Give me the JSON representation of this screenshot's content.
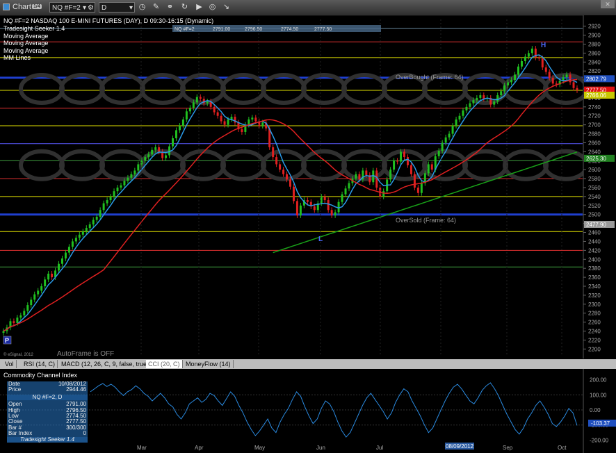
{
  "toolbar": {
    "app_title": "Chart",
    "app_badge": "1/4",
    "symbol": "NQ #F=2",
    "interval": "D"
  },
  "chart": {
    "header": "NQ #F=2 NASDAQ 100 E-MINI FUTURES (DAY), D 09:30-16:15 (Dynamic)",
    "studies": [
      "Tradesight Seeker 1.4",
      "Moving Average",
      "Moving Average",
      "Moving Average",
      "MM Lines"
    ],
    "ohlc_strip": [
      "NQ #F=2",
      "2791.00",
      "2796.50",
      "2774.50",
      "2777.50"
    ],
    "overbought_label": "OverBought (Frame: 64)",
    "oversold_label": "OverSold (Frame: 64)",
    "autoframe": "AutoFrame is OFF",
    "copyright": "© eSignal, 2012",
    "p_marker": "P",
    "h_marker": "H",
    "l_marker": "L"
  },
  "chart_data": [
    {
      "type": "candlestick",
      "title": "NQ #F=2 NASDAQ 100 E-MINI FUTURES (DAY), D 09:30-16:15 (Dynamic)",
      "yticks": [
        2200,
        2220,
        2240,
        2260,
        2280,
        2300,
        2320,
        2340,
        2360,
        2380,
        2400,
        2420,
        2440,
        2460,
        2480,
        2500,
        2520,
        2540,
        2560,
        2580,
        2600,
        2620,
        2640,
        2660,
        2680,
        2700,
        2720,
        2740,
        2760,
        2780,
        2800,
        2820,
        2840,
        2860,
        2880,
        2900,
        2920
      ],
      "ylim": [
        2185,
        2935
      ],
      "xticks": [
        "Mar",
        "Apr",
        "May",
        "Jun",
        "Jul",
        "Aug",
        "Sep",
        "Oct"
      ],
      "x_label_dates": {
        "Aug": "08/09/2012"
      },
      "price_tags": [
        {
          "value": "2802.79",
          "color": "#1f4fbf"
        },
        {
          "value": "2777.50",
          "color": "#e01010"
        },
        {
          "value": "2766.06",
          "color": "#c8c800"
        },
        {
          "value": "2625.30",
          "color": "#208020"
        },
        {
          "value": "2477.90",
          "color": "#9a9a9a"
        }
      ],
      "horizontal_lines": [
        {
          "value": 2915,
          "color": "#6a8aa0"
        },
        {
          "value": 2885,
          "color": "#e03030"
        },
        {
          "value": 2850,
          "color": "#e0e000"
        },
        {
          "value": 2805,
          "color": "#1f3fcf",
          "heavy": true
        },
        {
          "value": 2777,
          "color": "#e0e000"
        },
        {
          "value": 2737,
          "color": "#e03030"
        },
        {
          "value": 2698,
          "color": "#e0e000"
        },
        {
          "value": 2658,
          "color": "#5a5aff"
        },
        {
          "value": 2620,
          "color": "#40a040"
        },
        {
          "value": 2580,
          "color": "#e03030"
        },
        {
          "value": 2540,
          "color": "#e0e000"
        },
        {
          "value": 2500,
          "color": "#1f3fcf",
          "heavy": true
        },
        {
          "value": 2462,
          "color": "#e0e000"
        },
        {
          "value": 2420,
          "color": "#e03030"
        },
        {
          "value": 2383,
          "color": "#40a040"
        }
      ],
      "closes": [
        2240,
        2248,
        2262,
        2258,
        2270,
        2275,
        2285,
        2298,
        2310,
        2322,
        2330,
        2340,
        2355,
        2368,
        2360,
        2375,
        2390,
        2402,
        2415,
        2428,
        2440,
        2448,
        2455,
        2462,
        2470,
        2478,
        2488,
        2495,
        2510,
        2525,
        2532,
        2540,
        2552,
        2560,
        2565,
        2575,
        2582,
        2590,
        2598,
        2612,
        2620,
        2628,
        2634,
        2644,
        2650,
        2640,
        2626,
        2632,
        2652,
        2670,
        2688,
        2698,
        2712,
        2730,
        2738,
        2750,
        2762,
        2758,
        2748,
        2752,
        2740,
        2728,
        2720,
        2708,
        2700,
        2712,
        2718,
        2705,
        2690,
        2684,
        2700,
        2712,
        2716,
        2708,
        2698,
        2705,
        2692,
        2650,
        2628,
        2612,
        2600,
        2590,
        2578,
        2562,
        2530,
        2498,
        2520,
        2532,
        2528,
        2518,
        2510,
        2525,
        2540,
        2532,
        2510,
        2498,
        2505,
        2528,
        2545,
        2558,
        2570,
        2580,
        2590,
        2578,
        2598,
        2588,
        2572,
        2598,
        2560,
        2540,
        2552,
        2578,
        2600,
        2620,
        2618,
        2640,
        2628,
        2610,
        2590,
        2560,
        2548,
        2570,
        2592,
        2612,
        2600,
        2630,
        2642,
        2660,
        2672,
        2680,
        2698,
        2712,
        2720,
        2732,
        2740,
        2748,
        2755,
        2760,
        2766,
        2758,
        2760,
        2745,
        2752,
        2766,
        2775,
        2788,
        2795,
        2800,
        2812,
        2830,
        2842,
        2852,
        2860,
        2870,
        2850,
        2848,
        2828,
        2818,
        2805,
        2792,
        2790,
        2798,
        2806,
        2812,
        2795,
        2782,
        2777
      ]
    },
    {
      "type": "line",
      "title": "Commodity Channel Index",
      "yticks": [
        200,
        100,
        0,
        -100,
        -200
      ],
      "ylim": [
        -230,
        230
      ],
      "last_value": "-103.37",
      "xticks": [
        "Mar",
        "Apr",
        "May",
        "Jun",
        "Jul",
        "Aug",
        "Sep",
        "Oct"
      ],
      "values": [
        120,
        140,
        160,
        175,
        155,
        170,
        150,
        120,
        95,
        120,
        135,
        160,
        140,
        110,
        90,
        60,
        85,
        110,
        80,
        40,
        20,
        -30,
        -60,
        -20,
        40,
        60,
        80,
        50,
        70,
        110,
        95,
        60,
        30,
        75,
        120,
        90,
        30,
        -20,
        -80,
        -130,
        -170,
        -140,
        -100,
        -60,
        -120,
        -150,
        -80,
        -30,
        10,
        70,
        120,
        90,
        20,
        -40,
        -90,
        -60,
        10,
        60,
        40,
        -10,
        -80,
        -140,
        -180,
        -150,
        -90,
        -30,
        30,
        80,
        110,
        70,
        30,
        -10,
        -60,
        -20,
        50,
        100,
        140,
        120,
        60,
        10,
        -40,
        -100,
        -150,
        -120,
        -60,
        0,
        60,
        110,
        150,
        170,
        140,
        100,
        60,
        40,
        80,
        130,
        160,
        180,
        140,
        90,
        30,
        -30,
        -80,
        -130,
        -160,
        -120,
        -60,
        -20,
        30,
        60,
        20,
        -30,
        -90,
        -110,
        -80,
        -40,
        10,
        -20,
        -103
      ]
    }
  ],
  "tabs": [
    "Vol",
    "RSI (14, C)",
    "MACD (12, 26, C, 9, false, true)",
    "CCI (20, C)",
    "MoneyFlow (14)"
  ],
  "active_tab": 3,
  "data_window": {
    "rows": [
      {
        "label": "Date",
        "value": "10/08/2012"
      },
      {
        "label": "Price",
        "value": "2944.46"
      }
    ],
    "symbol": "NQ #F=2, D",
    "ohlc": [
      {
        "label": "Open",
        "value": "2791.00"
      },
      {
        "label": "High",
        "value": "2796.50"
      },
      {
        "label": "Low",
        "value": "2774.50"
      },
      {
        "label": "Close",
        "value": "2777.50"
      },
      {
        "label": "Bar #",
        "value": "300/300"
      },
      {
        "label": "Bar Index",
        "value": "0"
      }
    ],
    "footer": "Tradesight Seeker 1.4"
  },
  "colors": {
    "background": "#000000",
    "up_candle": "#20c020",
    "down_candle": "#e02020",
    "ma_blue": "#2a9ae8",
    "ma_red": "#e02020",
    "ma_green": "#18a018",
    "cci_line": "#2a8ae0"
  }
}
